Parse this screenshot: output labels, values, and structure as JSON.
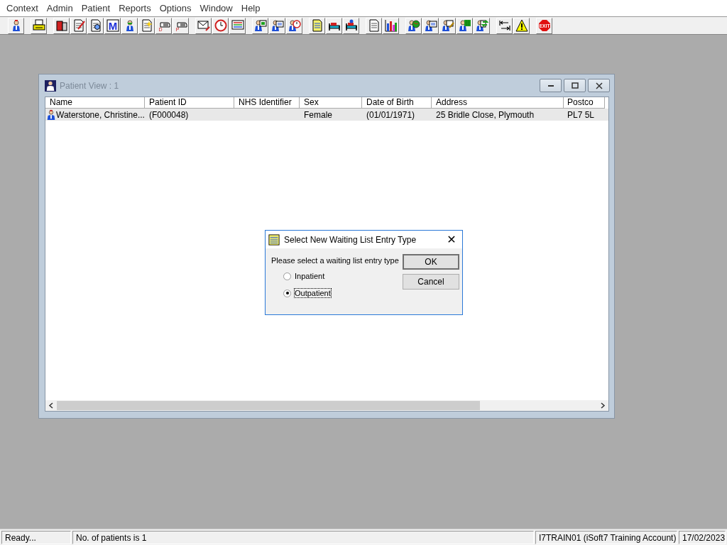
{
  "menu_bar": [
    "Context",
    "Admin",
    "Patient",
    "Reports",
    "Options",
    "Window",
    "Help"
  ],
  "toolbar": {
    "glyphs": [
      "M",
      "D",
      "P",
      "EXIT"
    ]
  },
  "patient_window": {
    "title": "Patient View : 1",
    "columns": [
      "Name",
      "Patient ID",
      "NHS Identifier",
      "Sex",
      "Date of Birth",
      "Address",
      "Postco"
    ],
    "rows": [
      {
        "selected": true,
        "cells": [
          "Waterstone, Christine...",
          "(F000048)",
          "",
          "Female",
          "(01/01/1971)",
          "25 Bridle Close, Plymouth",
          "PL7 5L"
        ]
      }
    ]
  },
  "dialog": {
    "title": "Select New Waiting List Entry Type",
    "close": "✕",
    "prompt": "Please select a waiting list entry type",
    "options": [
      {
        "label": "Inpatient",
        "selected": false
      },
      {
        "label": "Outpatient",
        "selected": true
      }
    ],
    "buttons": [
      "OK",
      "Cancel"
    ]
  },
  "status_bar": [
    "Ready...",
    "No. of patients is 1",
    "I7TRAIN01 (iSoft7 Training Account)",
    "17/02/2023"
  ]
}
